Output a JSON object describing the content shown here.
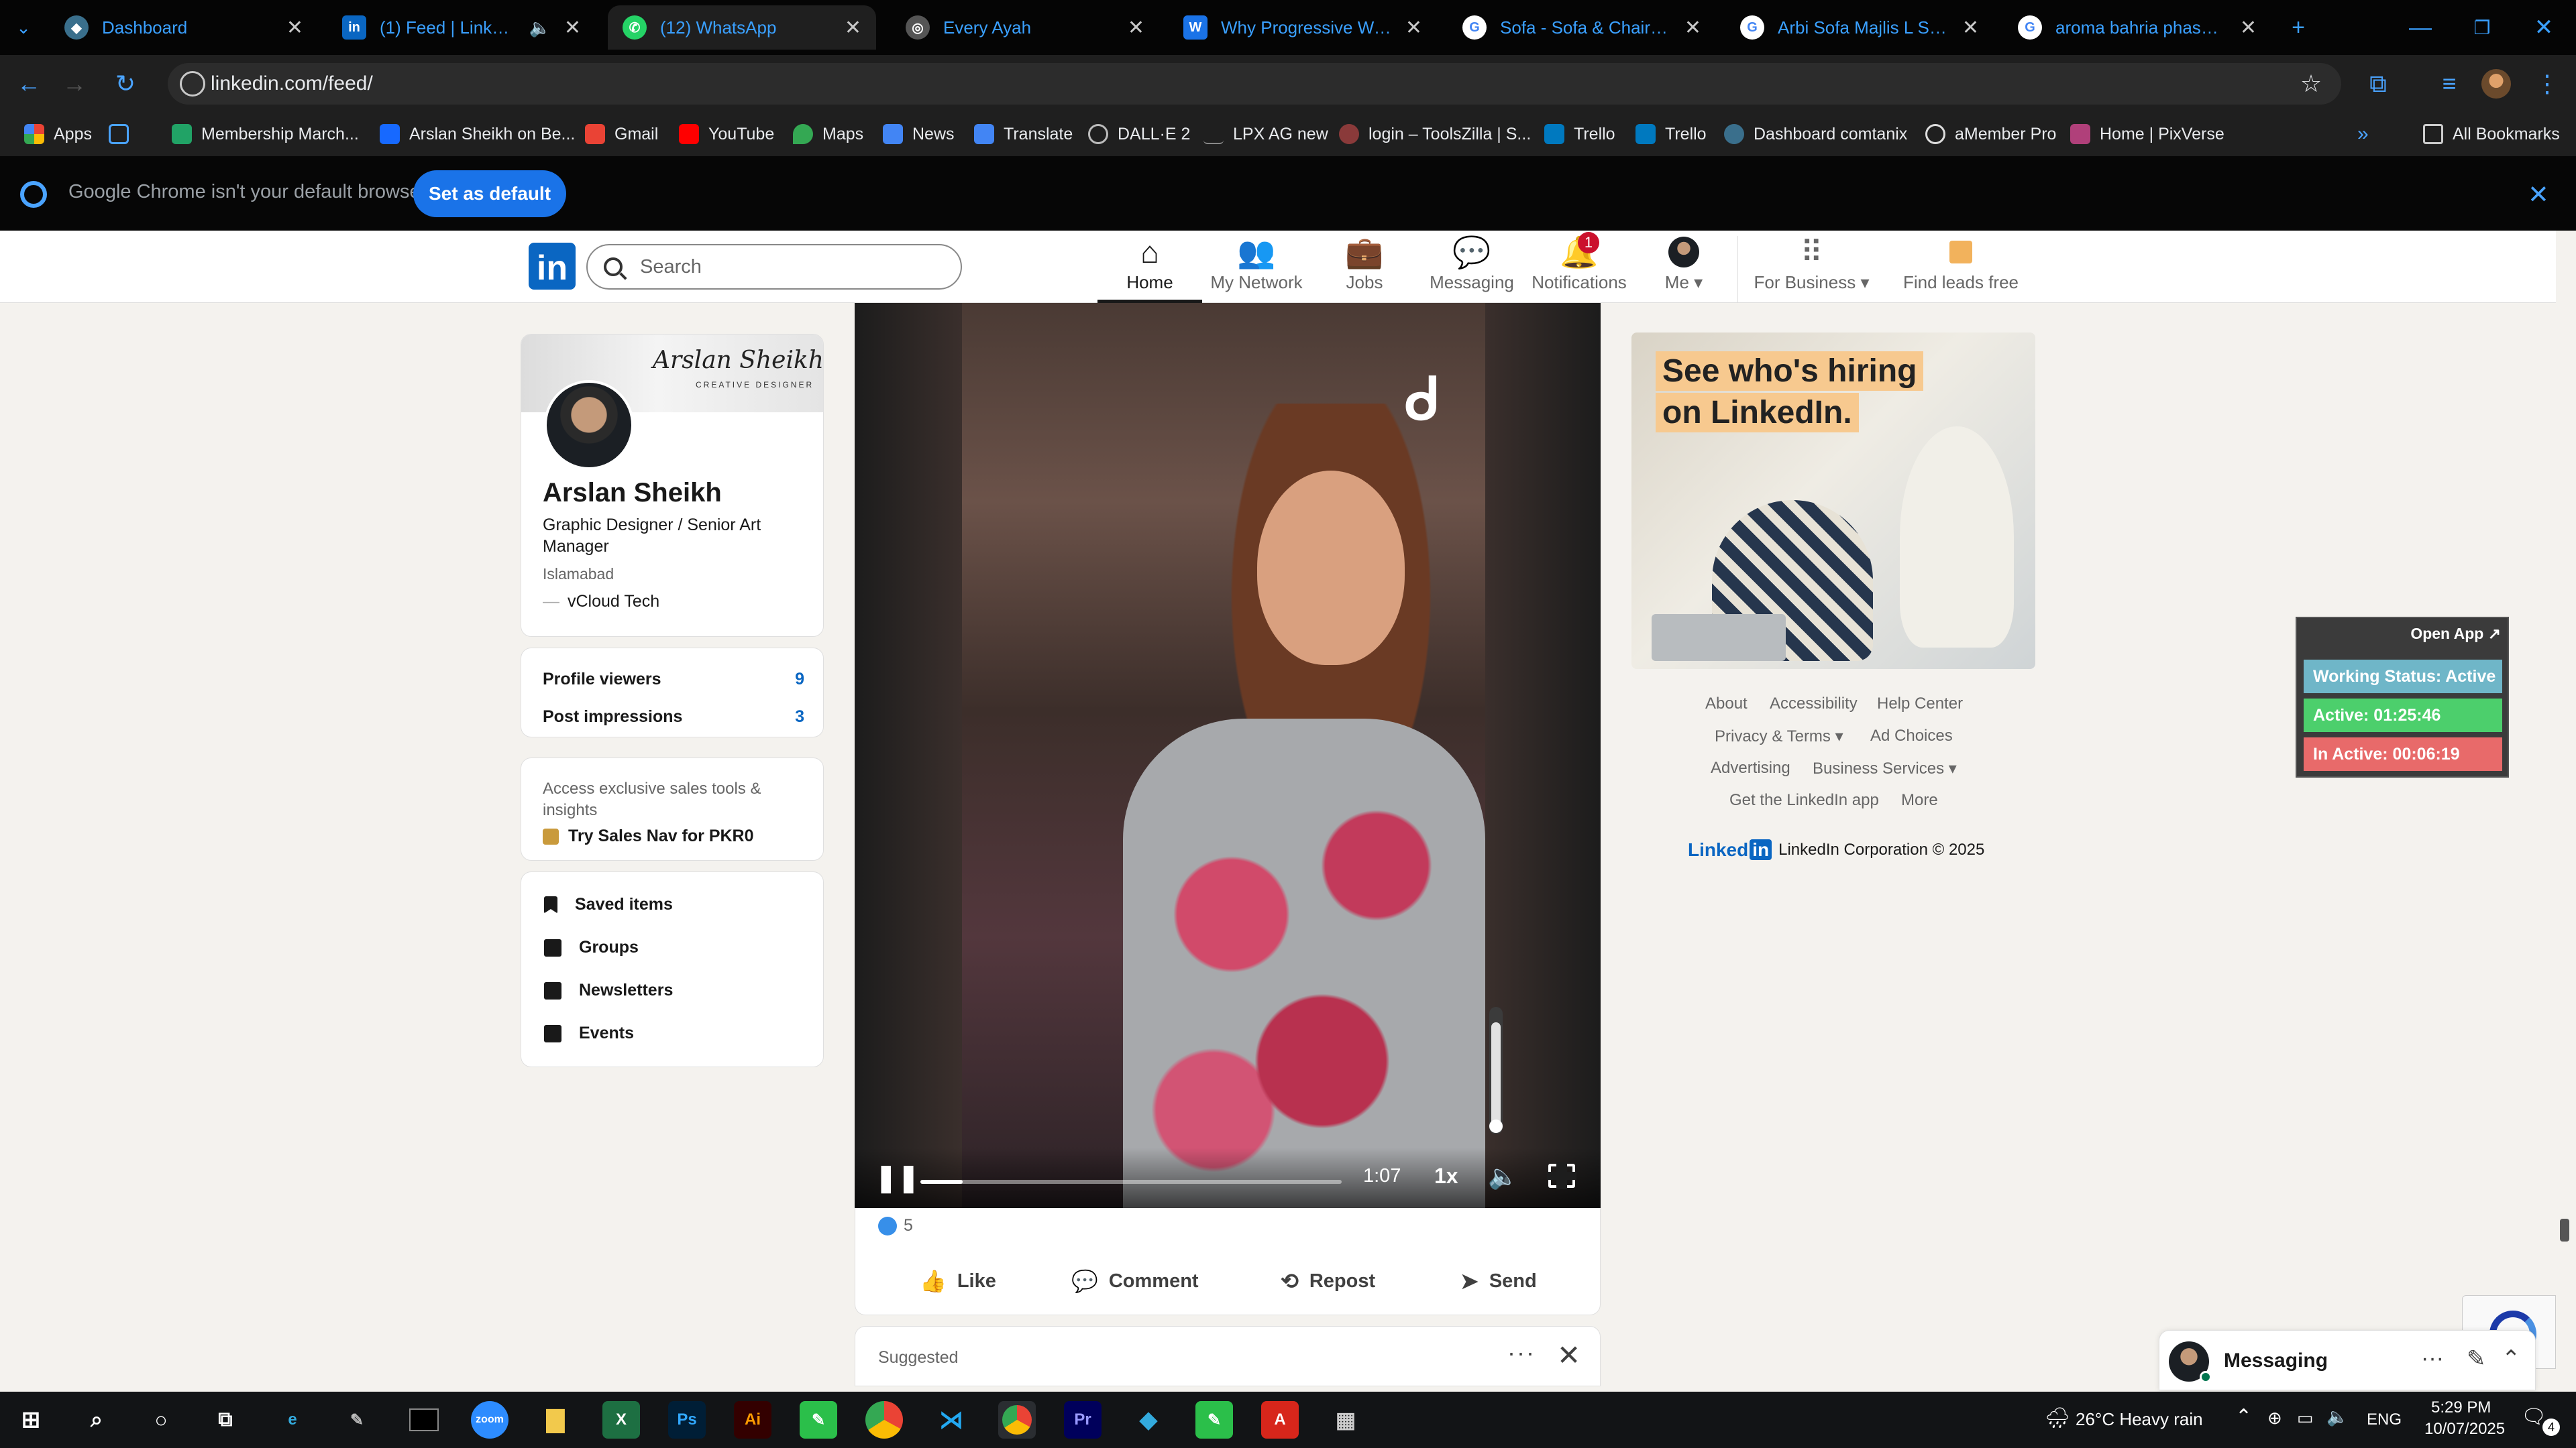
{
  "browser": {
    "tabs": [
      {
        "title": "Dashboard",
        "favicon": "dashboard-icon",
        "color": "#3aa0ff"
      },
      {
        "title": "(1) Feed | LinkedIn",
        "favicon": "linkedin-icon",
        "color": "#0a66c2",
        "audio": true
      },
      {
        "title": "(12) WhatsApp",
        "favicon": "whatsapp-icon",
        "color": "#25d366"
      },
      {
        "title": "Every Ayah",
        "favicon": "globe-icon",
        "color": "#888888"
      },
      {
        "title": "Why Progressive Web Ap",
        "favicon": "doc-icon",
        "color": "#1a73e8"
      },
      {
        "title": "Sofa - Sofa & Chairs for s",
        "favicon": "google-icon",
        "color": "#ffffff"
      },
      {
        "title": "Arbi Sofa Majlis L Shape S",
        "favicon": "google-icon",
        "color": "#ffffff"
      },
      {
        "title": "aroma bahria phase 8 - G",
        "favicon": "google-icon",
        "color": "#ffffff"
      }
    ],
    "url": "linkedin.com/feed/",
    "bookmarks": [
      {
        "label": "Apps"
      },
      {
        "label": "Membership March..."
      },
      {
        "label": "Arslan Sheikh on Be..."
      },
      {
        "label": "Gmail"
      },
      {
        "label": "YouTube"
      },
      {
        "label": "Maps"
      },
      {
        "label": "News"
      },
      {
        "label": "Translate"
      },
      {
        "label": "DALL·E 2"
      },
      {
        "label": "LPX AG new"
      },
      {
        "label": "login – ToolsZilla | S..."
      },
      {
        "label": "Trello"
      },
      {
        "label": "Trello"
      },
      {
        "label": "Dashboard comtanix"
      },
      {
        "label": "aMember Pro"
      },
      {
        "label": "Home | PixVerse"
      }
    ],
    "all_bookmarks": "All Bookmarks",
    "infobar": {
      "message": "Google Chrome isn't your default browser",
      "button": "Set as default"
    }
  },
  "linkedin": {
    "search_placeholder": "Search",
    "nav": [
      {
        "label": "Home",
        "icon": "home-icon",
        "active": true
      },
      {
        "label": "My Network",
        "icon": "network-icon"
      },
      {
        "label": "Jobs",
        "icon": "briefcase-icon"
      },
      {
        "label": "Messaging",
        "icon": "chat-icon"
      },
      {
        "label": "Notifications",
        "icon": "bell-icon",
        "badge": "1"
      },
      {
        "label": "Me",
        "icon": "avatar"
      },
      {
        "label": "For Business",
        "icon": "grid-icon"
      },
      {
        "label": "Find leads free",
        "icon": "sales-icon"
      }
    ],
    "profile": {
      "signature": "Arslan Sheikh",
      "signature_sub": "CREATIVE DESIGNER",
      "name": "Arslan Sheikh",
      "headline": "Graphic Designer / Senior Art Manager",
      "location": "Islamabad",
      "company": "vCloud Tech"
    },
    "stats": [
      {
        "label": "Profile viewers",
        "value": "9"
      },
      {
        "label": "Post impressions",
        "value": "3"
      }
    ],
    "premium": {
      "text": "Access exclusive sales tools & insights",
      "link": "Try Sales Nav for PKR0"
    },
    "shortcuts": [
      "Saved items",
      "Groups",
      "Newsletters",
      "Events"
    ],
    "video": {
      "time": "1:07",
      "speed": "1x",
      "progress": 0.1,
      "volume": 0.85
    },
    "post": {
      "reactions": "5",
      "actions": [
        "Like",
        "Comment",
        "Repost",
        "Send"
      ]
    },
    "suggested_label": "Suggested",
    "ad": {
      "line1": "See who's hiring",
      "line2": "on LinkedIn."
    },
    "footer_links": [
      "About",
      "Accessibility",
      "Help Center",
      "Privacy & Terms",
      "Ad Choices",
      "Advertising",
      "Business Services",
      "Get the LinkedIn app",
      "More"
    ],
    "copyright_brand": "Linked",
    "copyright_in": "in",
    "copyright": "LinkedIn Corporation © 2025",
    "messaging_label": "Messaging"
  },
  "tracker": {
    "open_app": "Open App ↗",
    "working_status": "Working Status: Active",
    "active": "Active: 01:25:46",
    "inactive": "In Active: 00:06:19",
    "colors": {
      "status": "#6fb6c8",
      "active": "#4ccf6c",
      "inactive": "#e86a6a"
    }
  },
  "taskbar": {
    "weather": "26°C  Heavy rain",
    "lang": "ENG",
    "time": "5:29 PM",
    "date": "10/07/2025",
    "notif_count": "4"
  }
}
